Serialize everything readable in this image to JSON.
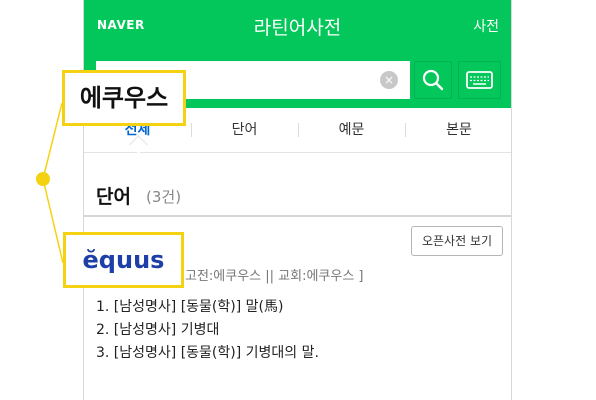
{
  "header": {
    "logo": "NAVER",
    "title": "라틴어사전",
    "right_link": "사전"
  },
  "search": {
    "value": "",
    "placeholder": "",
    "clear_glyph": "×",
    "search_icon": "search-icon",
    "keyboard_icon": "keyboard-icon"
  },
  "tabs": [
    {
      "label": "전체",
      "active": true
    },
    {
      "label": "단어",
      "active": false
    },
    {
      "label": "예문",
      "active": false
    },
    {
      "label": "본문",
      "active": false
    }
  ],
  "section": {
    "title": "단어",
    "count": "(3건)",
    "open_dict_button": "오픈사전 보기"
  },
  "entry": {
    "pronunciation": "고전:에쿠우스 || 교회:에쿠우스 ]",
    "definitions": [
      "1. [남성명사] [동물(학)] 말(馬)",
      "2. [남성명사] 기병대",
      "3. [남성명사] [동물(학)] 기병대의 말."
    ]
  },
  "callouts": {
    "korean": "에쿠우스",
    "latin": "ĕquus"
  },
  "colors": {
    "brand_green": "#03c75a",
    "highlight_yellow": "#f5d211",
    "active_tab_blue": "#0066cc",
    "latin_blue": "#1e3fa8"
  }
}
